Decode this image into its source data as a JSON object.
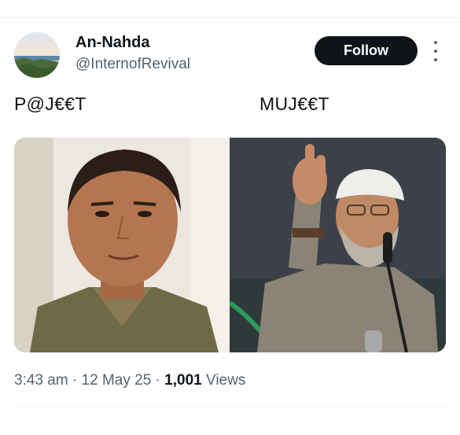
{
  "author": {
    "name": "An-Nahda",
    "handle": "@InternofRevival",
    "avatar_icon": "landscape-avatar"
  },
  "follow_label": "Follow",
  "post": {
    "text_left": "P@J€€T",
    "text_right": "MUJ€€T"
  },
  "media": {
    "left_image": "portrait-man-left",
    "right_image": "portrait-man-speaking-right"
  },
  "meta": {
    "time": "3:43 am",
    "sep1": " · ",
    "date": "12 May 25",
    "sep2": " · ",
    "views_count": "1,001",
    "views_label": " Views"
  },
  "colors": {
    "text_primary": "#0f1419",
    "text_secondary": "#536471",
    "follow_bg": "#0f1419",
    "divider": "#eff3f4"
  }
}
